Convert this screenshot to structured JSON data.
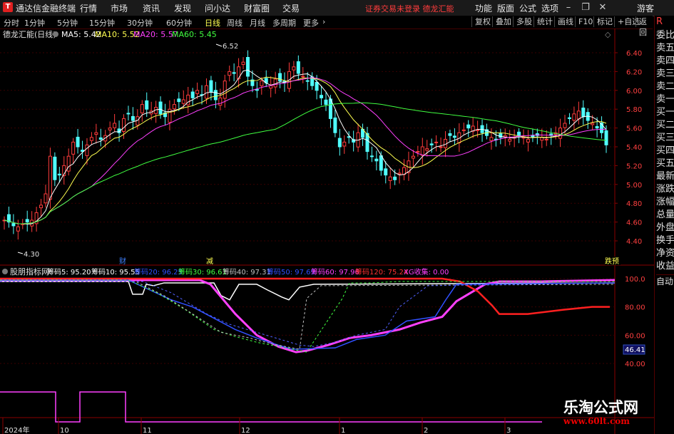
{
  "titlebar": {
    "app_name": "通达信金融终端",
    "menus": [
      "行情",
      "市场",
      "资讯",
      "发现",
      "问小达",
      "财富圈",
      "交易"
    ],
    "notice": "证券交易未登录  德龙汇能",
    "right_menus": [
      "功能",
      "版面",
      "公式",
      "选项"
    ],
    "guest": "游客"
  },
  "toolbar": {
    "periods": [
      "分时",
      "1分钟",
      "5分钟",
      "15分钟",
      "30分钟",
      "60分钟",
      "日线",
      "周线",
      "月线",
      "多周期",
      "更多"
    ],
    "active_period": "日线",
    "right_buttons": [
      "复权",
      "叠加",
      "多股",
      "统计",
      "画线",
      "F10",
      "标记",
      "+自选",
      "返回"
    ]
  },
  "main_chart": {
    "stock_label": "德龙汇能(日线)",
    "ma5": "MA5: 5.42",
    "ma10": "MA10: 5.52",
    "ma20": "MA20: 5.57",
    "ma60": "MA60: 5.45",
    "high_label": "6.52",
    "low_label": "4.30",
    "y_ticks": [
      "6.40",
      "6.20",
      "6.00",
      "5.80",
      "5.60",
      "5.40",
      "5.20",
      "5.00",
      "4.80",
      "4.60",
      "4.40"
    ],
    "marker_cai": "财",
    "marker_jian": "减",
    "marker_dieyu": "跌预"
  },
  "indicator": {
    "name": "股朋指标网",
    "items": [
      {
        "label": "筹码5: 95.20",
        "color": "#ffffff"
      },
      {
        "label": "筹码10: 95.55",
        "color": "#ffffff"
      },
      {
        "label": "筹码20: 96.25",
        "color": "#3050ff"
      },
      {
        "label": "筹码30: 96.61",
        "color": "#40ff40"
      },
      {
        "label": "筹码40: 97.31",
        "color": "#c0c0c0"
      },
      {
        "label": "筹码50: 97.69",
        "color": "#3050ff"
      },
      {
        "label": "筹码60: 97.96",
        "color": "#ff40ff"
      },
      {
        "label": "筹码120: 75.24",
        "color": "#ff3030"
      },
      {
        "label": "XG收集: 0.00",
        "color": "#ff40ff"
      }
    ],
    "y_ticks": [
      "100.0",
      "80.00",
      "60.00",
      "40.00"
    ],
    "current_value": "46.41"
  },
  "x_axis": {
    "labels": [
      "2024年",
      "10",
      "11",
      "12",
      "1",
      "2",
      "3"
    ]
  },
  "right_panel": {
    "items": [
      "委比",
      "卖五",
      "卖四",
      "卖三",
      "卖二",
      "卖一",
      "买一",
      "买二",
      "买三",
      "买四",
      "买五",
      "最新",
      "涨跌",
      "涨幅",
      "总量",
      "外盘",
      "换手",
      "净资",
      "收益"
    ],
    "bottom": "自动"
  },
  "watermark": {
    "line1": "乐淘公式网",
    "line2": "www.60lt.com"
  },
  "colors": {
    "up": "#ff3c3c",
    "down": "#50ffff",
    "ma5": "#ffffff",
    "ma10": "#ffff50",
    "ma20": "#ff40ff",
    "ma60": "#40ff40"
  }
}
